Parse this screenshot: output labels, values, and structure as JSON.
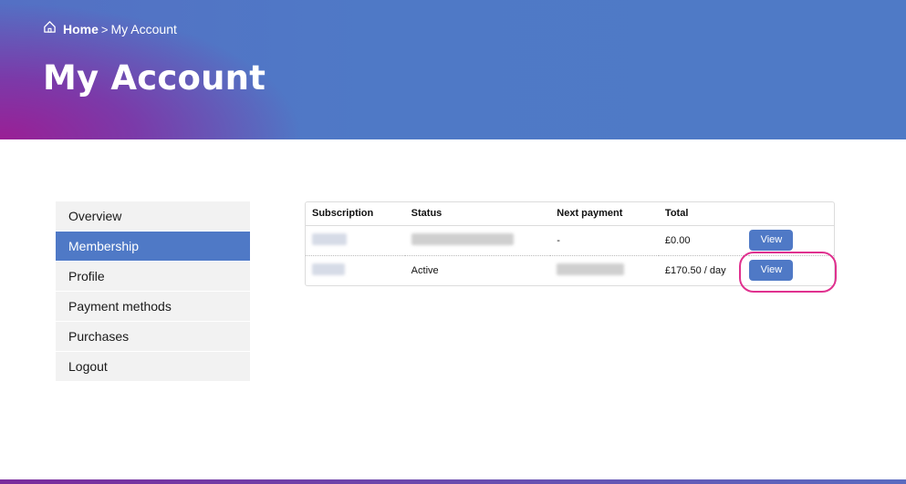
{
  "breadcrumb": {
    "home": "Home",
    "separator": ">",
    "current": "My Account"
  },
  "page_title": "My Account",
  "sidebar": {
    "items": [
      {
        "label": "Overview",
        "active": false
      },
      {
        "label": "Membership",
        "active": true
      },
      {
        "label": "Profile",
        "active": false
      },
      {
        "label": "Payment methods",
        "active": false
      },
      {
        "label": "Purchases",
        "active": false
      },
      {
        "label": "Logout",
        "active": false
      }
    ]
  },
  "subscriptions": {
    "columns": [
      "Subscription",
      "Status",
      "Next payment",
      "Total"
    ],
    "rows": [
      {
        "subscription": "",
        "status": "",
        "next_payment": "-",
        "total": "£0.00",
        "action": "View"
      },
      {
        "subscription": "",
        "status": "Active",
        "next_payment": "",
        "total": "£170.50 / day",
        "action": "View"
      }
    ]
  },
  "colors": {
    "accent": "#4f79c6",
    "highlight": "#e0318f",
    "hero_purple": "#9a1f95"
  }
}
